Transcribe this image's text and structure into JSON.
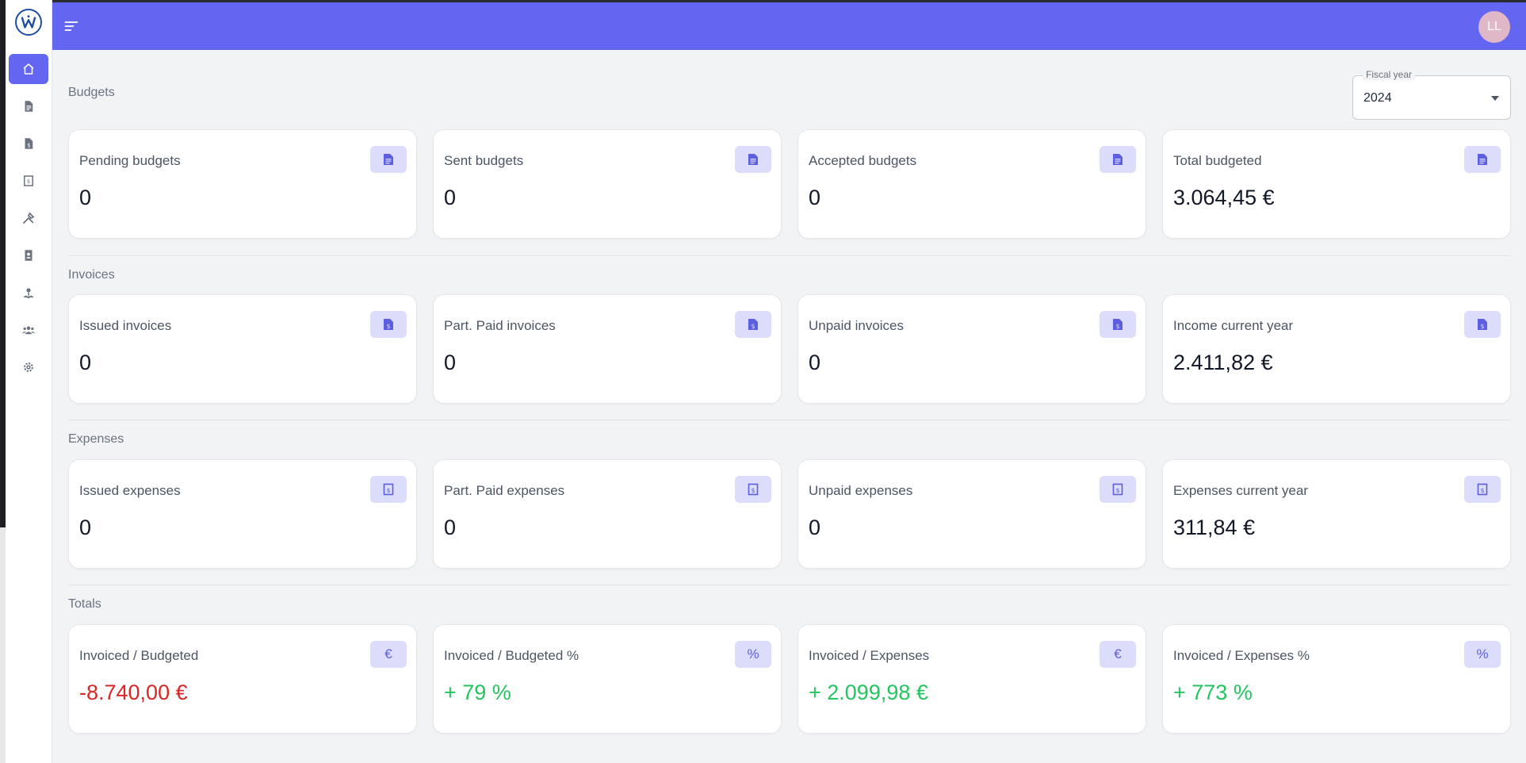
{
  "header": {
    "avatar_initials": "LL"
  },
  "fiscal_year": {
    "label": "Fiscal year",
    "value": "2024"
  },
  "sidebar": {
    "items": [
      {
        "name": "home",
        "icon": "home-icon",
        "active": true
      },
      {
        "name": "budgets",
        "icon": "document-icon",
        "active": false
      },
      {
        "name": "invoices",
        "icon": "invoice-icon",
        "active": false
      },
      {
        "name": "expenses",
        "icon": "receipt-icon",
        "active": false
      },
      {
        "name": "services",
        "icon": "tools-icon",
        "active": false
      },
      {
        "name": "contacts",
        "icon": "contact-book-icon",
        "active": false
      },
      {
        "name": "users",
        "icon": "user-pin-icon",
        "active": false
      },
      {
        "name": "groups",
        "icon": "users-group-icon",
        "active": false
      },
      {
        "name": "settings",
        "icon": "gear-icon",
        "active": false
      }
    ]
  },
  "sections": {
    "budgets": {
      "title": "Budgets",
      "cards": [
        {
          "label": "Pending budgets",
          "value": "0"
        },
        {
          "label": "Sent budgets",
          "value": "0"
        },
        {
          "label": "Accepted budgets",
          "value": "0"
        },
        {
          "label": "Total budgeted",
          "value": "3.064,45 €"
        }
      ]
    },
    "invoices": {
      "title": "Invoices",
      "cards": [
        {
          "label": "Issued invoices",
          "value": "0"
        },
        {
          "label": "Part. Paid invoices",
          "value": "0"
        },
        {
          "label": "Unpaid invoices",
          "value": "0"
        },
        {
          "label": "Income current year",
          "value": "2.411,82 €"
        }
      ]
    },
    "expenses": {
      "title": "Expenses",
      "cards": [
        {
          "label": "Issued expenses",
          "value": "0"
        },
        {
          "label": "Part. Paid expenses",
          "value": "0"
        },
        {
          "label": "Unpaid expenses",
          "value": "0"
        },
        {
          "label": "Expenses current year",
          "value": "311,84 €"
        }
      ]
    },
    "totals": {
      "title": "Totals",
      "cards": [
        {
          "label": "Invoiced / Budgeted",
          "value": "-8.740,00 €",
          "icon_text": "€"
        },
        {
          "label": "Invoiced / Budgeted %",
          "value": "+ 79 %",
          "icon_text": "%"
        },
        {
          "label": "Invoiced / Expenses",
          "value": "+ 2.099,98 €",
          "icon_text": "€"
        },
        {
          "label": "Invoiced / Expenses %",
          "value": "+ 773 %",
          "icon_text": "%"
        }
      ]
    }
  },
  "colors": {
    "accent": "#6366f1",
    "icon_bg": "#dcdcfb",
    "negative": "#dc2626",
    "positive": "#22c55e"
  }
}
